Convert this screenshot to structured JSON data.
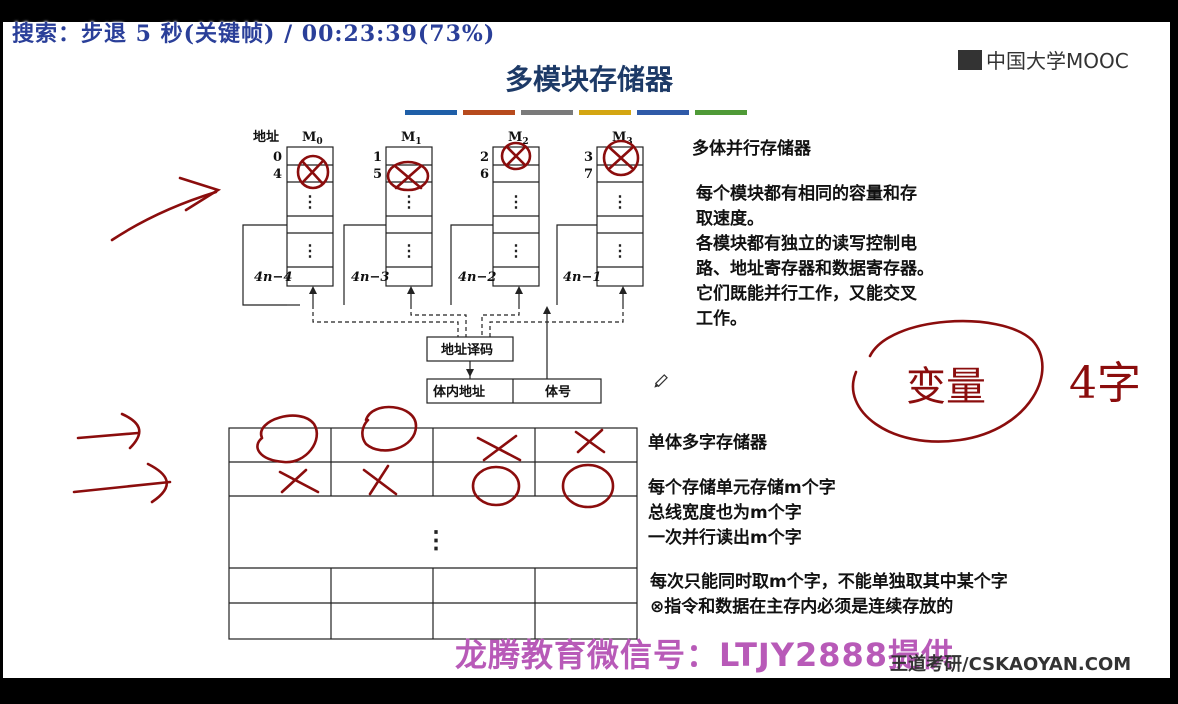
{
  "overlay": {
    "text": "搜索：步退 5 秒(关键帧) / 00:23:39(73%)"
  },
  "logo": {
    "text": "中国大学MOOC"
  },
  "slide": {
    "title": "多模块存储器",
    "bar_colors": [
      "#1f5fa8",
      "#b74a1d",
      "#7a7a7a",
      "#d4a612",
      "#2f5aa8",
      "#4f9a37"
    ]
  },
  "multi_bank": {
    "address_label": "地址",
    "modules": [
      {
        "name": "M0",
        "sub": "0",
        "addrs": [
          "0",
          "4"
        ],
        "last": "4n−4"
      },
      {
        "name": "M",
        "sub": "1",
        "addrs": [
          "1",
          "5"
        ],
        "last": "4n−3"
      },
      {
        "name": "M",
        "sub": "2",
        "addrs": [
          "2",
          "6"
        ],
        "last": "4n−2"
      },
      {
        "name": "M",
        "sub": "3",
        "addrs": [
          "3",
          "7"
        ],
        "last": "4n−1"
      }
    ],
    "decoder_label": "地址译码",
    "inner_addr_label": "体内地址",
    "bank_no_label": "体号"
  },
  "texts": {
    "multi_title": "多体并行存储器",
    "multi_lines": [
      "每个模块都有相同的容量和存",
      "取速度。",
      "各模块都有独立的读写控制电",
      "路、地址寄存器和数据寄存器。",
      "它们既能并行工作，又能交叉",
      "工作。"
    ],
    "single_title": "单体多字存储器",
    "single_lines": [
      "每个存储单元存储m个字",
      "总线宽度也为m个字",
      "一次并行读出m个字"
    ],
    "single_note": [
      "每次只能同时取m个字，不能单独取其中某个字",
      "⊗指令和数据在主存内必须是连续存放的"
    ],
    "handwriting_circle": "变量",
    "handwriting_side": "4字"
  },
  "watermark": {
    "text": "龙腾教育微信号：LTJY2888提供"
  },
  "footer": {
    "text": "王道考研/CSKAOYAN.COM"
  },
  "colors": {
    "ink": "#8b0d0d"
  }
}
